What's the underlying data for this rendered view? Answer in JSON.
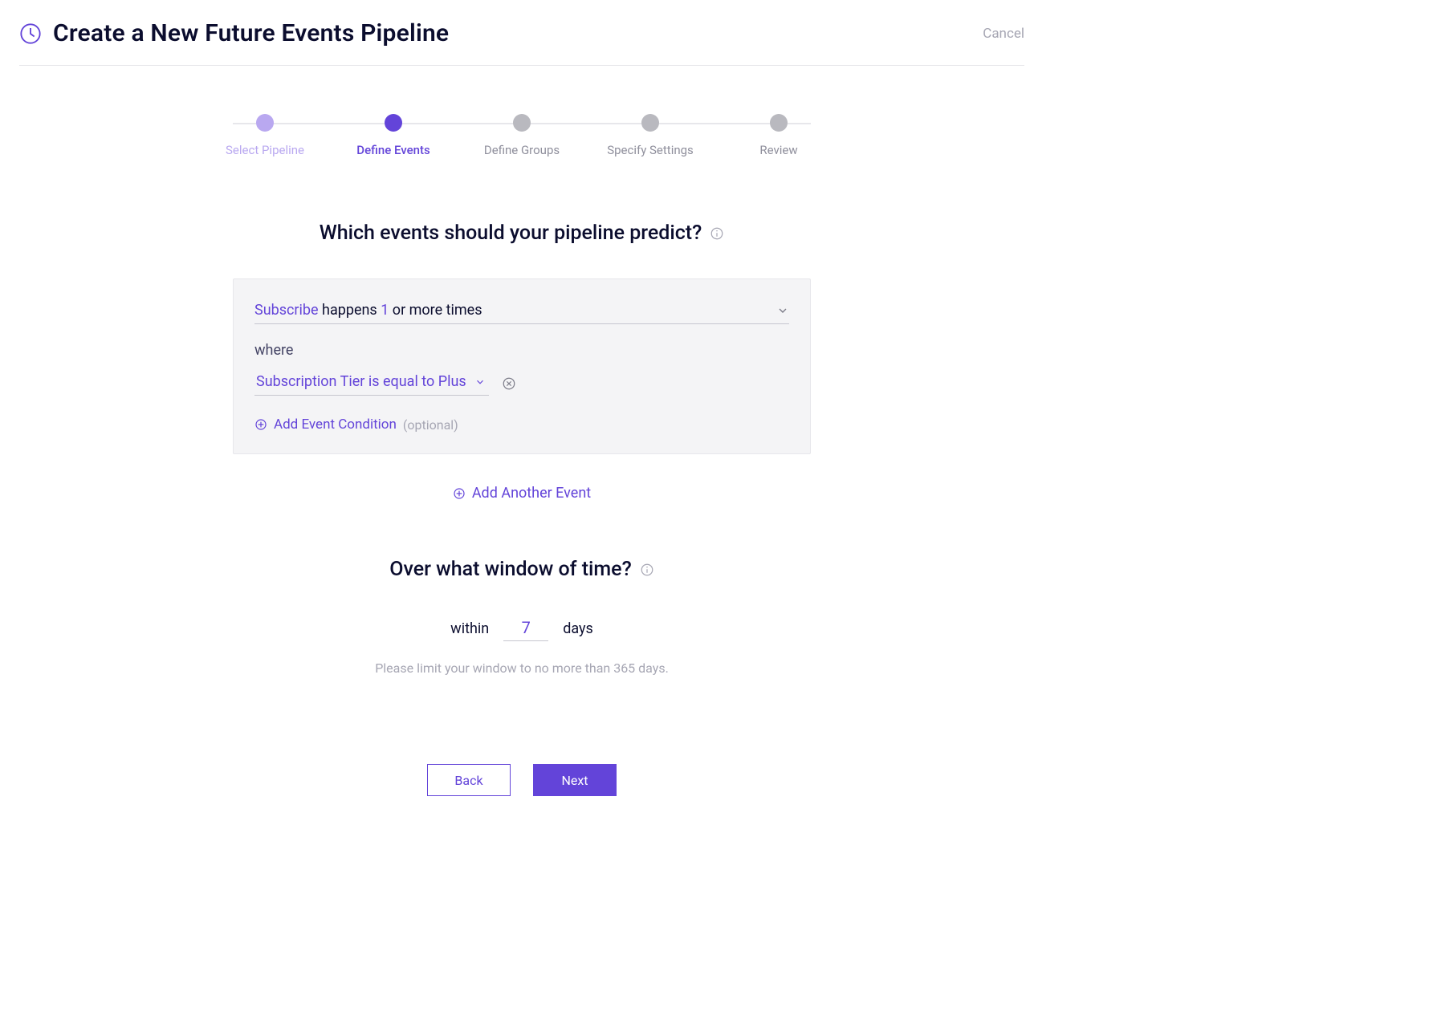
{
  "header": {
    "title": "Create a New Future Events Pipeline",
    "cancel": "Cancel"
  },
  "stepper": {
    "steps": [
      {
        "label": "Select Pipeline",
        "state": "done"
      },
      {
        "label": "Define Events",
        "state": "current"
      },
      {
        "label": "Define Groups",
        "state": "todo"
      },
      {
        "label": "Specify Settings",
        "state": "todo"
      },
      {
        "label": "Review",
        "state": "todo"
      }
    ]
  },
  "events_section": {
    "heading": "Which events should your pipeline predict?",
    "rule": {
      "event_name": "Subscribe",
      "happens_label": "happens",
      "count": "1",
      "qualifier": "or more times"
    },
    "where_label": "where",
    "condition": {
      "text": "Subscription Tier is equal to Plus"
    },
    "add_condition_label": "Add Event Condition",
    "add_condition_optional": "(optional)",
    "add_event_label": "Add Another Event"
  },
  "window_section": {
    "heading": "Over what window of time?",
    "prefix": "within",
    "value": "7",
    "suffix": "days",
    "hint": "Please limit your window to no more than 365 days."
  },
  "footer": {
    "back": "Back",
    "next": "Next"
  }
}
